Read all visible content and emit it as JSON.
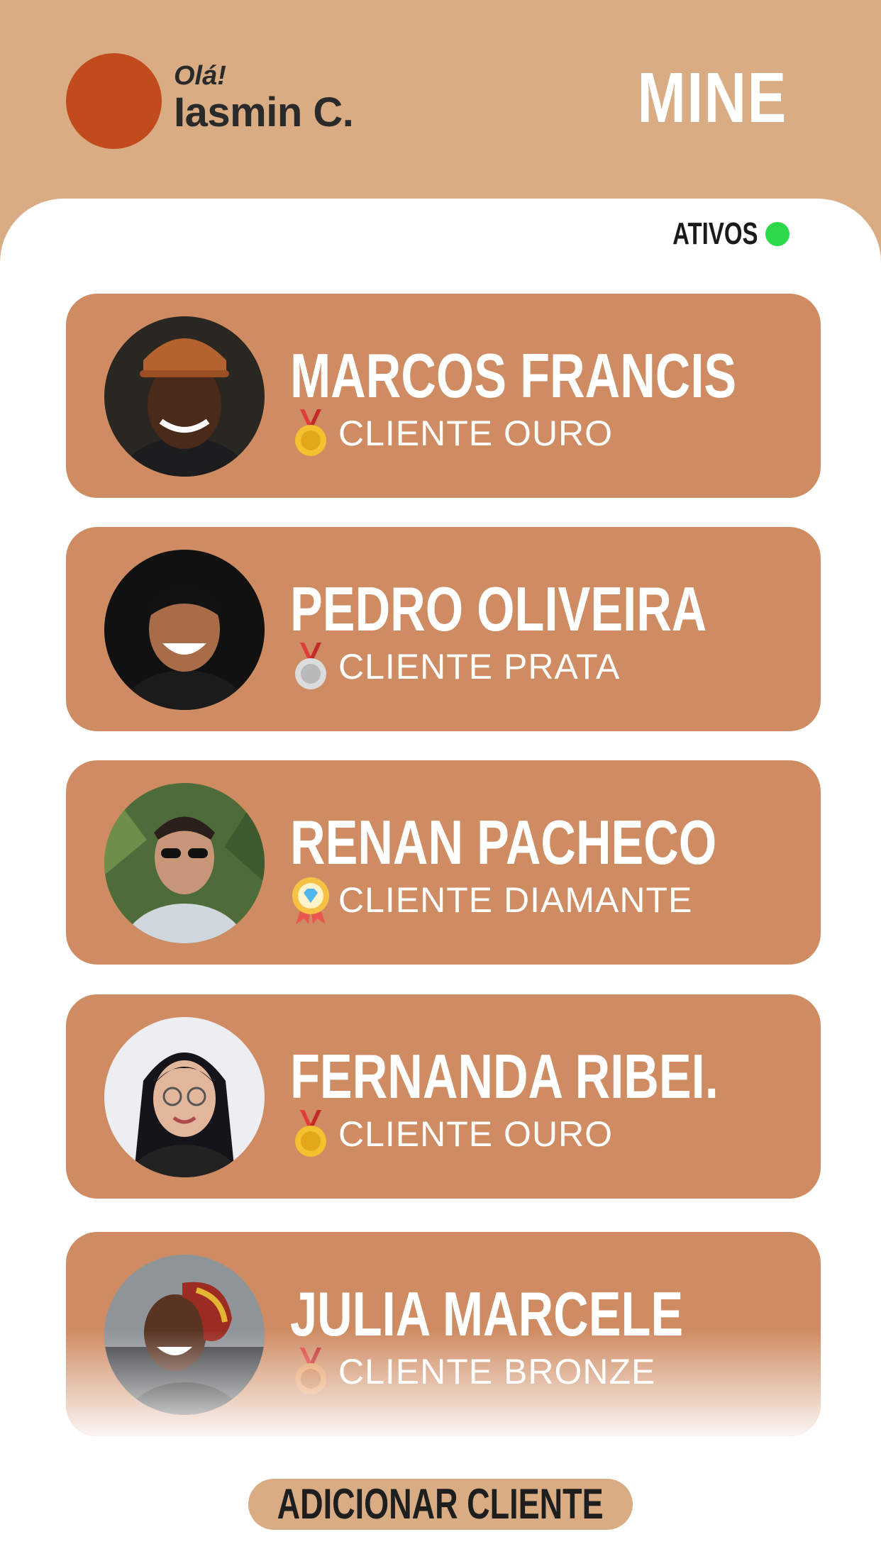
{
  "header": {
    "greeting": "Olá!",
    "username": "Iasmin C.",
    "brand": "MINE"
  },
  "status": {
    "label": "ATIVOS",
    "color": "#2bd94b"
  },
  "clients": [
    {
      "name": "MARCOS FRANCIS",
      "tier": "CLIENTE OURO",
      "medal": "gold-medal-icon"
    },
    {
      "name": "PEDRO OLIVEIRA",
      "tier": "CLIENTE PRATA",
      "medal": "silver-medal-icon"
    },
    {
      "name": "RENAN PACHECO",
      "tier": "CLIENTE DIAMANTE",
      "medal": "diamond-badge-icon"
    },
    {
      "name": "FERNANDA RIBEI.",
      "tier": "CLIENTE OURO",
      "medal": "gold-medal-icon"
    },
    {
      "name": "JULIA MARCELE",
      "tier": "CLIENTE BRONZE",
      "medal": "bronze-medal-icon"
    }
  ],
  "add_button": "ADICIONAR CLIENTE",
  "colors": {
    "header_bg": "#d9ac84",
    "card_bg": "#cf8c63",
    "user_avatar": "#c24b1d"
  }
}
